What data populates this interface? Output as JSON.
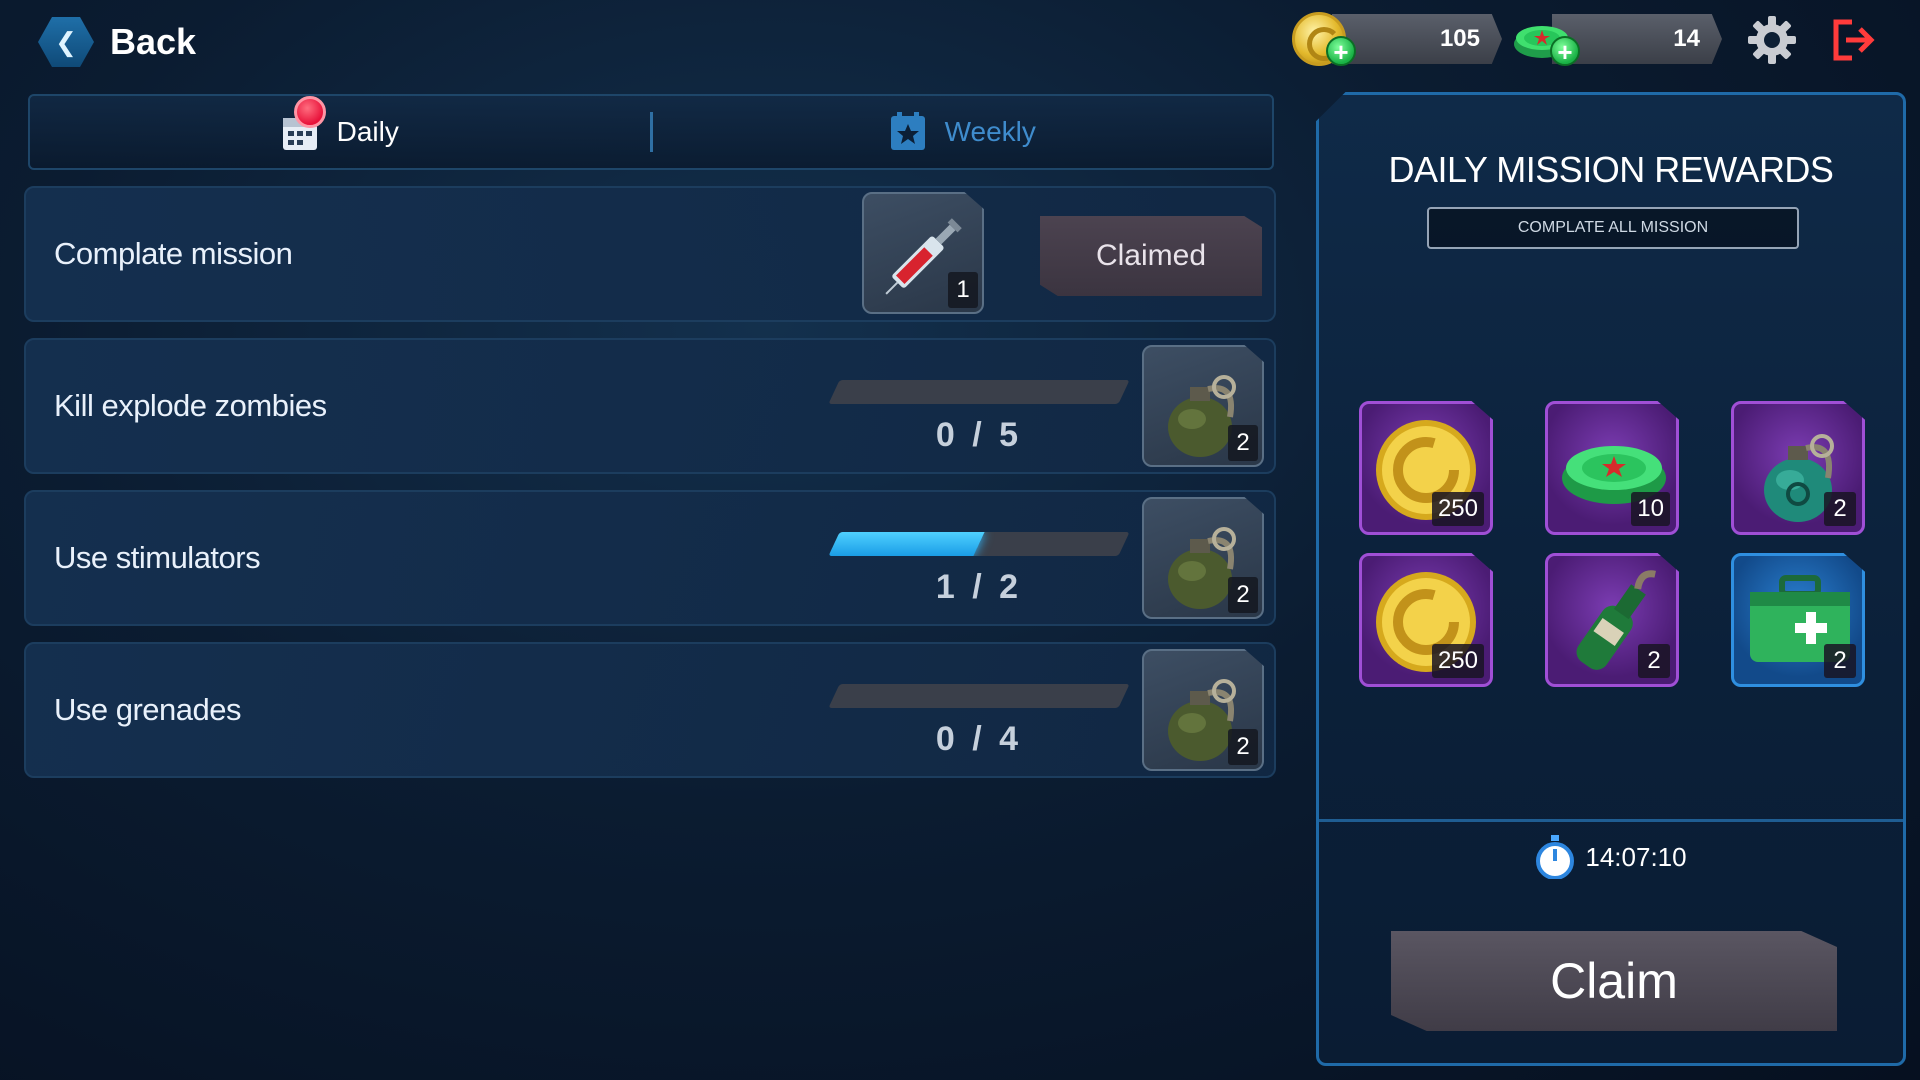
{
  "header": {
    "back_label": "Back",
    "coins": "105",
    "caps": "14"
  },
  "tabs": [
    {
      "label": "Daily",
      "active": true,
      "has_notification": true
    },
    {
      "label": "Weekly",
      "active": false
    }
  ],
  "missions": [
    {
      "title": "Complate mission",
      "reward_item": "syringe",
      "reward_qty": "1",
      "status": "Claimed"
    },
    {
      "title": "Kill explode zombies",
      "progress_text": "0 / 5",
      "progress": 0,
      "reward_item": "grenade",
      "reward_qty": "2"
    },
    {
      "title": "Use stimulators",
      "progress_text": "1 / 2",
      "progress": 0.5,
      "reward_item": "grenade",
      "reward_qty": "2"
    },
    {
      "title": "Use grenades",
      "progress_text": "0 / 4",
      "progress": 0,
      "reward_item": "grenade",
      "reward_qty": "2"
    }
  ],
  "rewards_panel": {
    "title": "DAILY MISSION REWARDS",
    "subtitle": "COMPLATE ALL MISSION",
    "items": [
      {
        "item": "coin",
        "qty": "250",
        "rarity": "purple"
      },
      {
        "item": "bottle-cap",
        "qty": "10",
        "rarity": "purple"
      },
      {
        "item": "bio-grenade",
        "qty": "2",
        "rarity": "purple"
      },
      {
        "item": "coin",
        "qty": "250",
        "rarity": "purple"
      },
      {
        "item": "molotov",
        "qty": "2",
        "rarity": "purple"
      },
      {
        "item": "medkit",
        "qty": "2",
        "rarity": "blue"
      }
    ],
    "timer": "14:07:10",
    "claim_label": "Claim"
  },
  "colors": {
    "accent": "#1f6aa8",
    "progress": "#1a9de6",
    "notification": "#e8123a",
    "rarity_purple": "#a04fd6",
    "rarity_blue": "#2f8fe0"
  }
}
